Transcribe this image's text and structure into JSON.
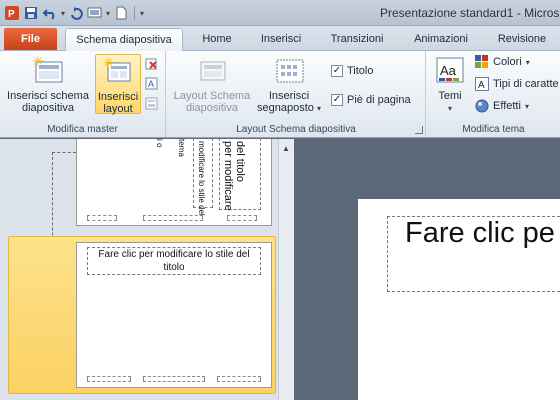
{
  "window": {
    "title": "Presentazione standard1 - Micros"
  },
  "tabs": {
    "file": "File",
    "items": [
      "Schema diapositiva",
      "Home",
      "Inserisci",
      "Transizioni",
      "Animazioni",
      "Revisione"
    ]
  },
  "ribbon": {
    "master": {
      "insert_master": "Inserisci schema\ndiapositiva",
      "insert_layout": "Inserisci\nlayout",
      "label": "Modifica master"
    },
    "layout": {
      "master_layout": "Layout Schema\ndiapositiva",
      "insert_placeholder": "Inserisci\nsegnaposto",
      "title_check": "Titolo",
      "footer_check": "Piè di pagina",
      "label": "Layout Schema diapositiva"
    },
    "theme": {
      "themes": "Temi",
      "colors": "Colori",
      "fonts": "Tipi di caratte",
      "effects": "Effetti",
      "label": "Modifica tema"
    }
  },
  "thumbnails": {
    "thumb1_vtext_a": "modificare lo stile del",
    "thumb1_vtext_b": "del titolo",
    "thumb1_vtext_c": "per modificare",
    "thumb1_vtext_d": "tema",
    "thumb1_vtext_e": "i o",
    "thumb2_title": "Fare clic per modificare lo stile del titolo"
  },
  "slide": {
    "title_text": "Fare clic pe"
  },
  "colors": {
    "file_tab": "#d5532a",
    "selected_thumb": "#fbd66e",
    "workspace": "#5c6778"
  }
}
